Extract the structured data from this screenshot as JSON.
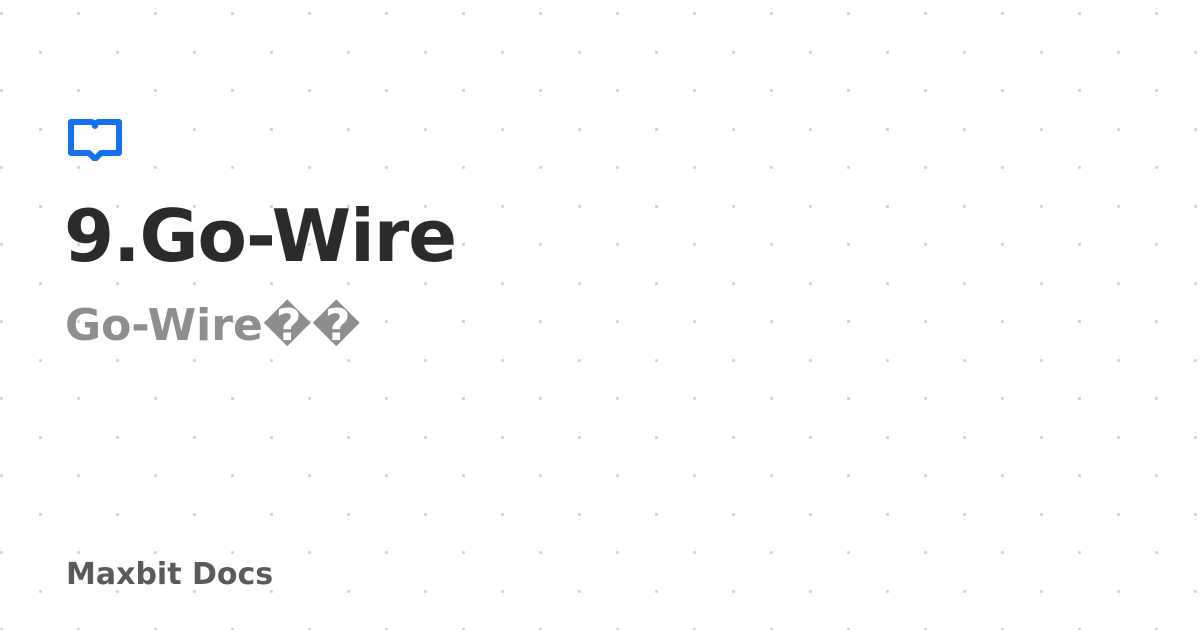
{
  "card": {
    "icon": "open-book-icon",
    "accent_color": "#1670f0",
    "title": "9.Go-Wire",
    "subtitle": "Go-Wire��",
    "site_name": "Maxbit Docs"
  }
}
